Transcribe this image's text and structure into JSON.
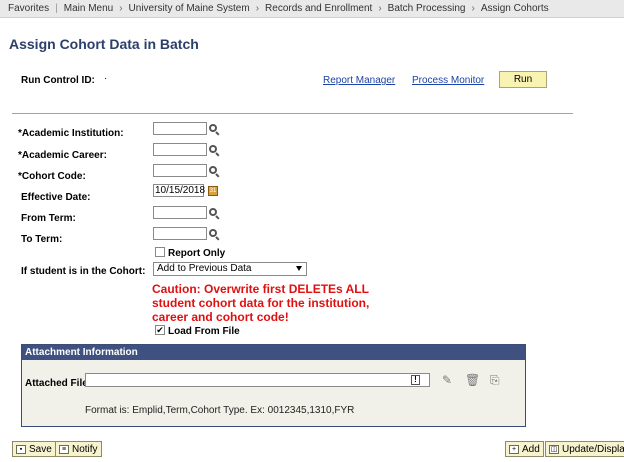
{
  "breadcrumb": {
    "favorites": "Favorites",
    "main_menu": "Main Menu",
    "items": [
      "University of Maine System",
      "Records and Enrollment",
      "Batch Processing",
      "Assign Cohorts"
    ]
  },
  "page_title": "Assign Cohort Data in Batch",
  "run_control": {
    "label": "Run Control ID:",
    "value": "·",
    "report_manager": "Report Manager",
    "process_monitor": "Process Monitor",
    "run_label": "Run"
  },
  "fields": {
    "academic_institution": "*Academic Institution:",
    "academic_career": "*Academic Career:",
    "cohort_code": "*Cohort Code:",
    "effective_date": "Effective Date:",
    "effective_date_value": "10/15/2018",
    "from_term": "From Term:",
    "to_term": "To Term:",
    "report_only": "Report Only",
    "in_cohort_label": "If student is in the Cohort:",
    "in_cohort_value": "Add to Previous Data",
    "caution": "Caution: Overwrite first DELETEs ALL student cohort data for the institution, career and cohort code!",
    "load_from_file": "Load From File",
    "load_from_file_checked": true
  },
  "attachment": {
    "header": "Attachment Information",
    "file_label": "Attached File",
    "format_text": "Format is: Emplid,Term,Cohort Type. Ex: 0012345,1310,FYR"
  },
  "buttons": {
    "save": "Save",
    "notify": "Notify",
    "add": "Add",
    "update_display": "Update/Display"
  }
}
